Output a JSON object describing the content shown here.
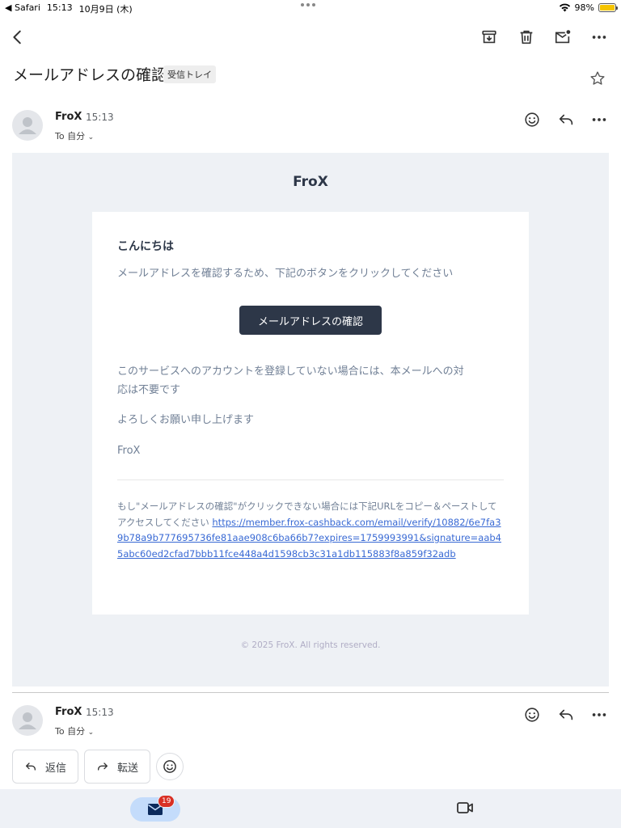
{
  "status_bar": {
    "back_app": "Safari",
    "time": "15:13",
    "date": "10月9日 (木)",
    "battery": "98%",
    "battery_level": 0.98
  },
  "toolbar": {
    "icons": [
      "back-icon",
      "archive-icon",
      "trash-icon",
      "mark-unread-icon",
      "more-icon"
    ]
  },
  "email": {
    "subject": "メールアドレスの確認",
    "label": "受信トレイ",
    "message_header": {
      "sender": "FroX",
      "time": "15:13",
      "recipient": "To 自分"
    },
    "body": {
      "brand": "FroX",
      "greeting": "こんにちは",
      "intro": "メールアドレスを確認するため、下記のボタンをクリックしてください",
      "button_label": "メールアドレスの確認",
      "note_line1": "このサービスへのアカウントを登録していない場合には、本メールへの対",
      "note_line2": "応は不要です",
      "closing": "よろしくお願い申し上げます",
      "signature": "FroX",
      "fallback_text": "もし\"メールアドレスの確認\"がクリックできない場合には下記URLをコピー＆ペーストしてアクセスしてください ",
      "fallback_url": "https://member.frox-cashback.com/email/verify/10882/6e7fa39b78a9b777695736fe81aae908c6ba66b7?expires=1759993991&signature=aab45abc60ed2cfad7bbb11fce448a4d1598cb3c31a1db115883f8a859f32adb",
      "footer": "© 2025 FroX. All rights reserved."
    },
    "second_message_header": {
      "sender": "FroX",
      "time": "15:13",
      "recipient": "To 自分"
    }
  },
  "actions": {
    "reply_label": "返信",
    "forward_label": "転送"
  },
  "bottom_nav": {
    "mail_badge": "19"
  },
  "colors": {
    "button_bg": "#2d3748",
    "link": "#3869d4",
    "badge": "#d93025",
    "mail_body_bg": "#eef1f5"
  }
}
